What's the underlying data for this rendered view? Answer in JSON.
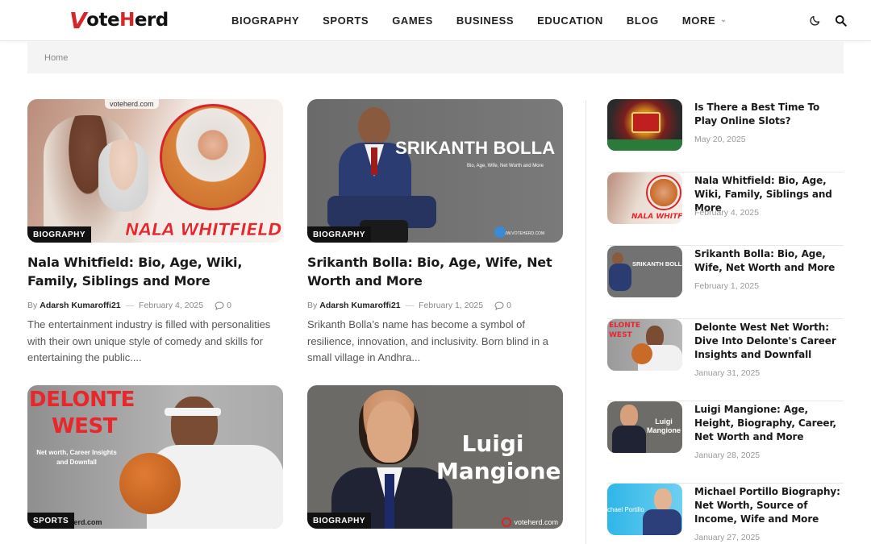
{
  "site": {
    "logo_text_v": "V",
    "logo_text_rest": "ote",
    "logo_text_h": "H",
    "logo_text_end": "erd"
  },
  "nav": {
    "items": [
      "BIOGRAPHY",
      "SPORTS",
      "GAMES",
      "BUSINESS",
      "EDUCATION",
      "BLOG"
    ],
    "more_label": "MORE"
  },
  "icons": {
    "theme_toggle": "moon-icon",
    "search": "search-icon",
    "comment": "comment-icon"
  },
  "breadcrumb": {
    "home": "Home"
  },
  "colors": {
    "brand_red": "#d6262a",
    "category_bg": "#111111"
  },
  "posts": [
    {
      "category": "BIOGRAPHY",
      "title": "Nala Whitfield: Bio, Age, Wiki, Family, Siblings and More",
      "by": "By",
      "author": "Adarsh Kumaroffi21",
      "date": "February 4, 2025",
      "comments": "0",
      "excerpt": "The entertainment industry is filled with personalities with their own unique style of comedy and skills for entertaining the public....",
      "image_text": "NALA WHITFIELD",
      "image_watermark": "voteherd.com"
    },
    {
      "category": "BIOGRAPHY",
      "title": "Srikanth Bolla: Bio, Age, Wife, Net Worth and More",
      "by": "By",
      "author": "Adarsh Kumaroffi21",
      "date": "February 1, 2025",
      "comments": "0",
      "excerpt": "Srikanth Bolla’s name has become a symbol of resilience, innovation, and inclusivity. Born blind in a small village in Andhra...",
      "image_text": "SRIKANTH BOLLA",
      "image_subtext": "Bio, Age, Wife, Net Worth and More",
      "image_watermark": "WWW.VOTEHERD.COM"
    },
    {
      "category": "SPORTS",
      "image_text_1": "DELONTE",
      "image_text_2": "WEST",
      "image_subtext": "Net worth, Career Insights and Downfall",
      "image_watermark": "herd.com"
    },
    {
      "category": "BIOGRAPHY",
      "image_text_1": "Luigi",
      "image_text_2": "Mangione",
      "image_watermark": "voteherd.com"
    }
  ],
  "sidebar": [
    {
      "title": "Is There a Best Time To Play Online Slots?",
      "date": "May 20, 2025"
    },
    {
      "title": "Nala Whitfield: Bio, Age, Wiki, Family, Siblings and More",
      "date": "February 4, 2025",
      "thumb_text": "NALA WHITFIE"
    },
    {
      "title": "Srikanth Bolla: Bio, Age, Wife, Net Worth and More",
      "date": "February 1, 2025",
      "thumb_text": "SRIKANTH BOLLA"
    },
    {
      "title": "Delonte West Net Worth: Dive Into Delonte's Career Insights and Downfall",
      "date": "January 31, 2025",
      "thumb_text": "ELONTE WEST"
    },
    {
      "title": "Luigi Mangione: Age, Height, Biography, Career, Net Worth and More",
      "date": "January 28, 2025",
      "thumb_text": "Luigi Mangione"
    },
    {
      "title": "Michael Portillo Biography: Net Worth, Source of Income, Wife and More",
      "date": "January 27, 2025",
      "thumb_text": "chael Portillo"
    }
  ]
}
